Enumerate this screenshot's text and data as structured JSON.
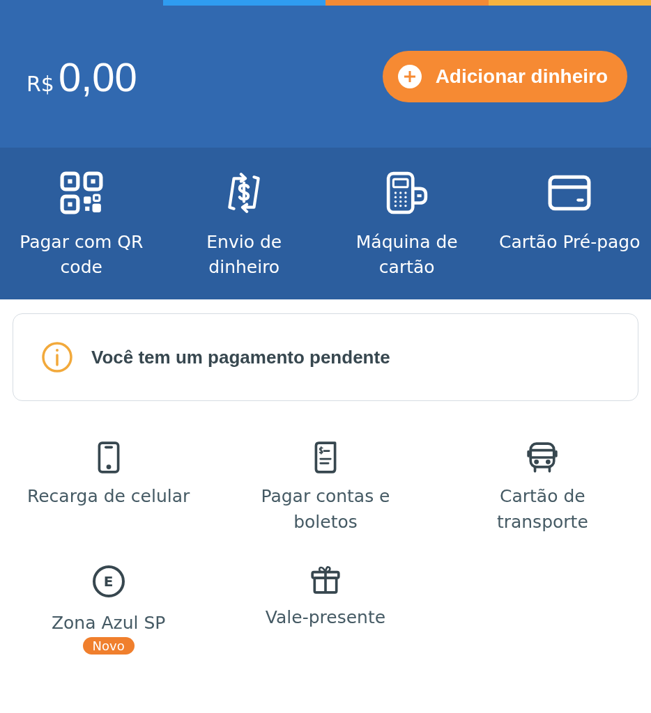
{
  "balance": {
    "currency": "R$",
    "amount": "0,00"
  },
  "add_money_button": {
    "label": "Adicionar dinheiro"
  },
  "quick_actions": [
    {
      "kind": "qr",
      "label": "Pagar com QR code"
    },
    {
      "kind": "transfer",
      "label": "Envio de dinheiro"
    },
    {
      "kind": "terminal",
      "label": "Máquina de cartão"
    },
    {
      "kind": "card",
      "label": "Cartão Pré-pago"
    }
  ],
  "notice": {
    "text": "Você tem um pagamento pendente"
  },
  "services": [
    {
      "kind": "phone",
      "label": "Recarga de celular"
    },
    {
      "kind": "bill",
      "label": "Pagar contas e boletos"
    },
    {
      "kind": "bus",
      "label": "Cartão de transporte"
    },
    {
      "kind": "letter",
      "icon_letter": "E",
      "label": "Zona Azul SP",
      "badge": "Novo"
    },
    {
      "kind": "gift",
      "label": "Vale-presente"
    }
  ]
}
